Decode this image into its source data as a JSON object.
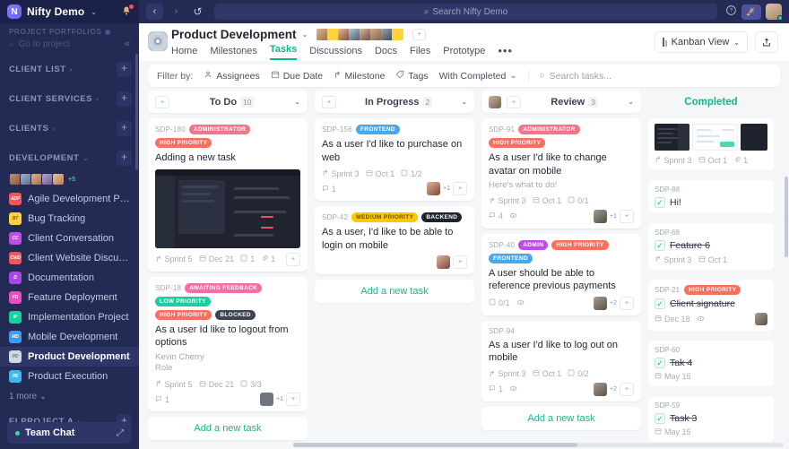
{
  "colors": {
    "accent_green": "#14b789",
    "sidebar_bg": "#232a54",
    "topbar_bg": "#252b55",
    "board_bg": "#f4f6f8"
  },
  "sidebar": {
    "workspace": "Nifty Demo",
    "workspace_caret": "⌄",
    "logo_glyph": "N",
    "bell_icon": "🔔",
    "portfolio_label": "PROJECT PORTFOLIOS",
    "search_icon": "⌕",
    "search_placeholder": "Go to project",
    "collapse_icon": "«",
    "groups": [
      {
        "label": "CLIENT LIST",
        "arrow": "›",
        "plus": "+"
      },
      {
        "label": "CLIENT SERVICES",
        "arrow": "›",
        "plus": "+"
      },
      {
        "label": "CLIENTS",
        "arrow": "›",
        "plus": "+"
      },
      {
        "label": "DEVELOPMENT",
        "arrow": "⌄",
        "plus": "+"
      }
    ],
    "member_more": "+5",
    "projects": [
      {
        "label": "Agile Development Proj...",
        "badge": "ADP",
        "color": "#f2555a"
      },
      {
        "label": "Bug Tracking",
        "badge": "BT",
        "color": "#ffd23f"
      },
      {
        "label": "Client Conversation",
        "badge": "CC",
        "color": "#c04ce8"
      },
      {
        "label": "Client Website Discussion",
        "badge": "CWD",
        "color": "#f2555a"
      },
      {
        "label": "Documentation",
        "badge": "D",
        "color": "#a648e8"
      },
      {
        "label": "Feature Deployment",
        "badge": "FD",
        "color": "#e84ec2"
      },
      {
        "label": "Implementation Project",
        "badge": "IP",
        "color": "#18cfa0"
      },
      {
        "label": "Mobile Development",
        "badge": "MD",
        "color": "#3b9bf5"
      },
      {
        "label": "Product Development",
        "badge": "PD",
        "color": "#8d97a8",
        "active": true
      },
      {
        "label": "Product Execution",
        "badge": "PE",
        "color": "#3bb9f5"
      }
    ],
    "more_label": "1 more ⌄",
    "bottom_group": {
      "label": "EI PROJECT A",
      "arrow": "›",
      "plus": "+"
    },
    "team_chat": {
      "label": "Team Chat",
      "expand_icon": "⤢"
    }
  },
  "topbar": {
    "back_icon": "‹",
    "forward_icon": "›",
    "history_icon": "↺",
    "search_icon": "⌕",
    "search_placeholder": "Search Nifty Demo",
    "help_icon": "?",
    "rocket_icon": "🚀"
  },
  "project_header": {
    "title": "Product Development",
    "caret": "⌄",
    "add_member_icon": "+",
    "tabs": [
      {
        "label": "Home",
        "active": false
      },
      {
        "label": "Milestones",
        "active": false
      },
      {
        "label": "Tasks",
        "active": true
      },
      {
        "label": "Discussions",
        "active": false
      },
      {
        "label": "Docs",
        "active": false
      },
      {
        "label": "Files",
        "active": false
      },
      {
        "label": "Prototype",
        "active": false
      }
    ],
    "overflow": "•••",
    "view_selector": "Kanban View",
    "view_caret": "⌄",
    "share_icon": "⇪"
  },
  "filter_bar": {
    "label": "Filter by:",
    "items": [
      {
        "label": "Assignees",
        "icon": "👤"
      },
      {
        "label": "Due Date",
        "icon": "📅"
      },
      {
        "label": "Milestone",
        "icon": "↱"
      },
      {
        "label": "Tags",
        "icon": "🏷"
      },
      {
        "label": "With Completed",
        "icon": "",
        "caret": "⌄"
      }
    ],
    "search_icon": "⌕",
    "search_placeholder": "Search tasks..."
  },
  "board": {
    "add_task_label": "Add a new task",
    "columns": [
      {
        "name": "To Do",
        "count": "10",
        "chevron": "⌄",
        "assign_icon": "+",
        "cards": [
          {
            "id": "SDP-180",
            "tags": [
              {
                "label": "ADMINISTRATOR",
                "color": "#f2768a"
              },
              {
                "label": "HIGH PRIORITY",
                "color": "#fb6f5d"
              }
            ],
            "title": "Adding a new task",
            "has_thumbnail": true,
            "meta": [
              {
                "icon": "↱",
                "label": "Sprint 5"
              },
              {
                "icon": "📅",
                "label": "Dec 21"
              },
              {
                "icon": "☑",
                "label": "1"
              },
              {
                "icon": "📎",
                "label": "1"
              }
            ],
            "foot": []
          },
          {
            "id": "SDP-18",
            "tags": [
              {
                "label": "AWAITING FEEDBACK",
                "color": "#f46ea6"
              },
              {
                "label": "LOW PRIORITY",
                "color": "#18cfa0"
              },
              {
                "label": "HIGH PRIORITY",
                "color": "#fb6f5d"
              },
              {
                "label": "BLOCKED",
                "color": "#3d4350"
              }
            ],
            "title": "As a user Id like to logout from options",
            "sub": "Kevin Cherry\nRole",
            "has_thumbnail": false,
            "meta": [
              {
                "icon": "↱",
                "label": "Sprint 5"
              },
              {
                "icon": "📅",
                "label": "Dec 21"
              },
              {
                "icon": "☑",
                "label": "3/3"
              }
            ],
            "foot": [
              {
                "icon": "💬",
                "label": "1"
              }
            ],
            "avatar_extra": "+1"
          }
        ]
      },
      {
        "name": "In Progress",
        "count": "2",
        "chevron": "⌄",
        "assign_icon": "+",
        "cards": [
          {
            "id": "SDP-156",
            "tags": [
              {
                "label": "FRONTEND",
                "color": "#4aa8e8"
              }
            ],
            "title": "As a user I'd like to purchase on web",
            "has_thumbnail": false,
            "meta": [
              {
                "icon": "↱",
                "label": "Sprint 3"
              },
              {
                "icon": "📅",
                "label": "Oct 1"
              },
              {
                "icon": "☑",
                "label": "1/2"
              }
            ],
            "foot": [
              {
                "icon": "💬",
                "label": "1"
              }
            ],
            "avatar_extra": "+1"
          },
          {
            "id": "SDP-42",
            "tags": [
              {
                "label": "MEDIUM PRIORITY",
                "color": "#ffc800"
              },
              {
                "label": "BACKEND",
                "color": "#1f2430"
              }
            ],
            "title": "As a user, I'd like to be able to login on mobile",
            "has_thumbnail": false,
            "meta": [],
            "foot": []
          }
        ]
      },
      {
        "name": "Review",
        "count": "3",
        "chevron": "⌄",
        "assign_icon": "+",
        "has_head_avatar": true,
        "cards": [
          {
            "id": "SDP-91",
            "tags": [
              {
                "label": "ADMINISTRATOR",
                "color": "#f2768a"
              },
              {
                "label": "HIGH PRIORITY",
                "color": "#fb6f5d"
              }
            ],
            "title": "As a user I'd like to change avatar on mobile",
            "sub": "Here's what to do!",
            "has_thumbnail": false,
            "meta": [
              {
                "icon": "↱",
                "label": "Sprint 3"
              },
              {
                "icon": "📅",
                "label": "Oct 1"
              },
              {
                "icon": "☑",
                "label": "0/1"
              }
            ],
            "foot": [
              {
                "icon": "💬",
                "label": "4"
              },
              {
                "icon": "👁",
                "label": ""
              }
            ],
            "avatar_extra": "+1"
          },
          {
            "id": "SDP-40",
            "tags": [
              {
                "label": "ADMIN",
                "color": "#c04ce8"
              },
              {
                "label": "HIGH PRIORITY",
                "color": "#fb6f5d"
              },
              {
                "label": "FRONTEND",
                "color": "#4aa8e8"
              }
            ],
            "title": "A user should be able to reference previous payments",
            "has_thumbnail": false,
            "meta": [],
            "foot": [
              {
                "icon": "☑",
                "label": "0/1"
              },
              {
                "icon": "👁",
                "label": ""
              }
            ],
            "avatar_extra": "+2"
          },
          {
            "id": "SDP-94",
            "tags": [],
            "title": "As a user I'd like to log out on mobile",
            "has_thumbnail": false,
            "meta": [
              {
                "icon": "↱",
                "label": "Sprint 3"
              },
              {
                "icon": "📅",
                "label": "Oct 1"
              },
              {
                "icon": "☑",
                "label": "0/2"
              }
            ],
            "foot": [
              {
                "icon": "💬",
                "label": "1"
              },
              {
                "icon": "👁",
                "label": ""
              }
            ],
            "avatar_extra": "+2"
          }
        ]
      },
      {
        "name": "Completed",
        "count": "",
        "chevron": "",
        "cards": [
          {
            "id": "",
            "title": "",
            "has_images": true,
            "meta": [
              {
                "icon": "↱",
                "label": "Sprint 3"
              },
              {
                "icon": "📅",
                "label": "Oct 1"
              },
              {
                "icon": "📎",
                "label": "1"
              }
            ]
          },
          {
            "id": "SDP-88",
            "title": "Hi!",
            "checked": true,
            "strike": false,
            "tags": [],
            "meta": []
          },
          {
            "id": "SDP-68",
            "title": "Feature 6",
            "checked": true,
            "strike": true,
            "tags": [],
            "meta": [
              {
                "icon": "↱",
                "label": "Sprint 3"
              },
              {
                "icon": "📅",
                "label": "Oct 1"
              }
            ]
          },
          {
            "id": "SDP-21",
            "title": "Client signature",
            "checked": true,
            "strike": true,
            "tags": [
              {
                "label": "HIGH PRIORITY",
                "color": "#fb6f5d"
              }
            ],
            "meta": [
              {
                "icon": "📅",
                "label": "Dec 18"
              },
              {
                "icon": "👁",
                "label": ""
              }
            ],
            "has_avatar": true
          },
          {
            "id": "SDP-60",
            "title": "Tak 4",
            "checked": true,
            "strike": true,
            "tags": [],
            "meta": [
              {
                "icon": "📅",
                "label": "May 15"
              }
            ]
          },
          {
            "id": "SDP-59",
            "title": "Task 3",
            "checked": true,
            "strike": true,
            "tags": [],
            "meta": [
              {
                "icon": "📅",
                "label": "May 15"
              }
            ]
          }
        ]
      }
    ]
  }
}
